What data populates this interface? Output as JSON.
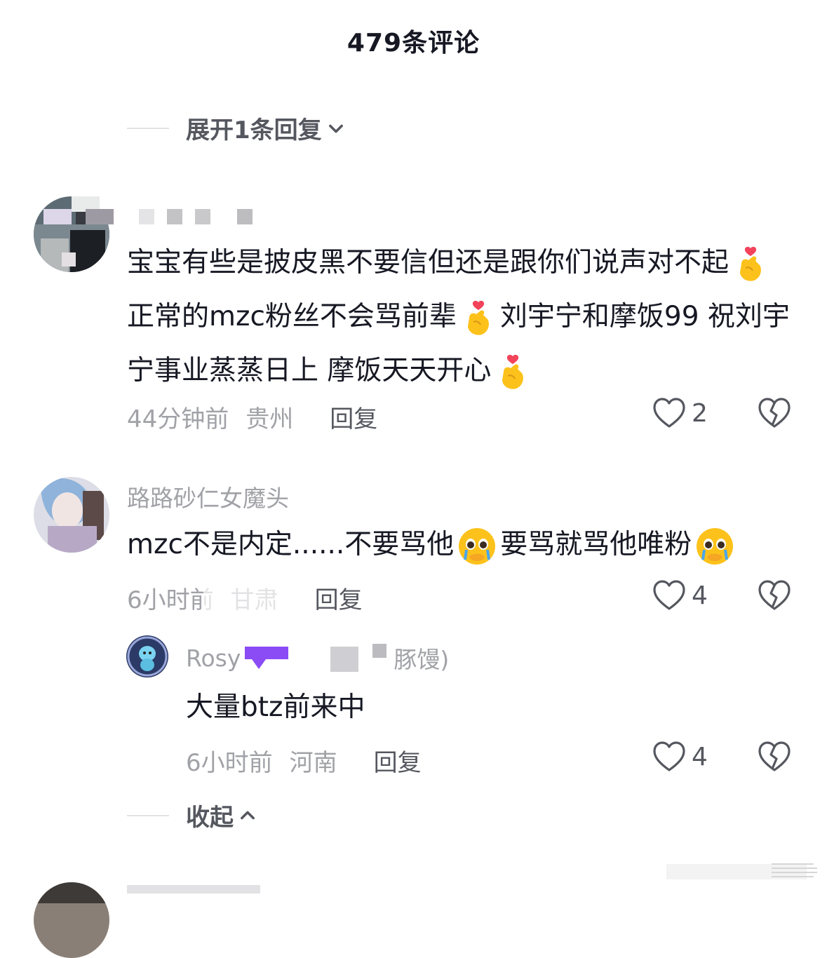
{
  "header": {
    "title": "479条评论"
  },
  "expand_top": {
    "label": "展开1条回复"
  },
  "comments": [
    {
      "username": "",
      "text_parts": [
        "宝宝有些是披皮黑不要信但还是跟你们说声对不起",
        "正常的mzc粉丝不会骂前辈",
        "刘宇宁和摩饭99 祝刘宇宁事业蒸蒸日上 摩饭天天开心"
      ],
      "time": "44分钟前",
      "location": "贵州",
      "reply_label": "回复",
      "likes": "2"
    },
    {
      "username": "路路砂仁女魔头",
      "text_parts": [
        "mzc不是内定......不要骂他",
        "要骂就骂他唯粉"
      ],
      "time": "6小时前",
      "location": "甘肃",
      "reply_label": "回复",
      "likes": "4"
    }
  ],
  "reply": {
    "username_prefix": "Rosy",
    "username_suffix": "豚馒)",
    "text": "大量btz前来中",
    "time": "6小时前",
    "location": "河南",
    "reply_label": "回复",
    "likes": "4"
  },
  "collapse": {
    "label": "收起"
  },
  "next_comment": {
    "username": " "
  },
  "icons": {
    "heart": "heart-outline-icon",
    "dislike": "broken-heart-icon",
    "chevron_down": "chevron-down-icon",
    "chevron_up": "chevron-up-icon",
    "finger_heart": "finger-heart-emoji",
    "pleading_tears": "pleading-tears-emoji"
  },
  "colors": {
    "text_primary": "#161823",
    "text_secondary": "#a1a2a7",
    "text_mid": "#55575f",
    "reply_badge": "#8b4cf6"
  }
}
